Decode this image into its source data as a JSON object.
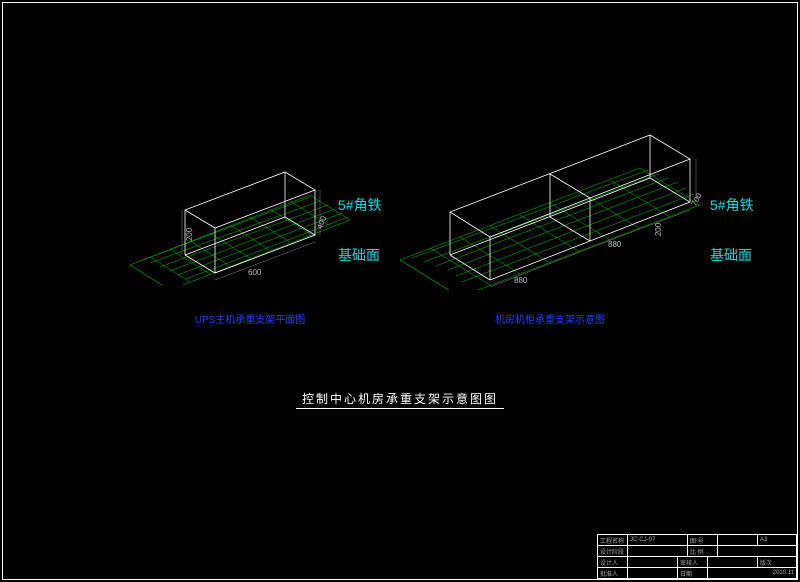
{
  "frame": {
    "color": "#ffffff"
  },
  "left_figure": {
    "annot_angle": "5#角铁",
    "annot_base": "基础面",
    "caption": "UPS主机承重支架平面图",
    "dim_w": "600",
    "dim_d": "400",
    "dim_h": "200"
  },
  "right_figure": {
    "annot_angle": "5#角铁",
    "annot_base": "基础面",
    "caption": "机房机柜承重支架示意图",
    "dim_w1": "880",
    "dim_w2": "880",
    "dim_d": "700",
    "dim_h": "200"
  },
  "main_title": "控制中心机房承重支架示意图图",
  "title_block": {
    "proj_name_label": "工程名称",
    "proj_code": "JC-CJ-07",
    "dwg_no_label": "图 号",
    "scale_label": "比 例",
    "sheet_label": "A3",
    "design_label": "设计人",
    "check_label": "审核人",
    "approve_label": "批准人",
    "date_label": "日期",
    "date_value": "2010.11",
    "rev_label": "版次",
    "stage_label": "设计阶段"
  }
}
